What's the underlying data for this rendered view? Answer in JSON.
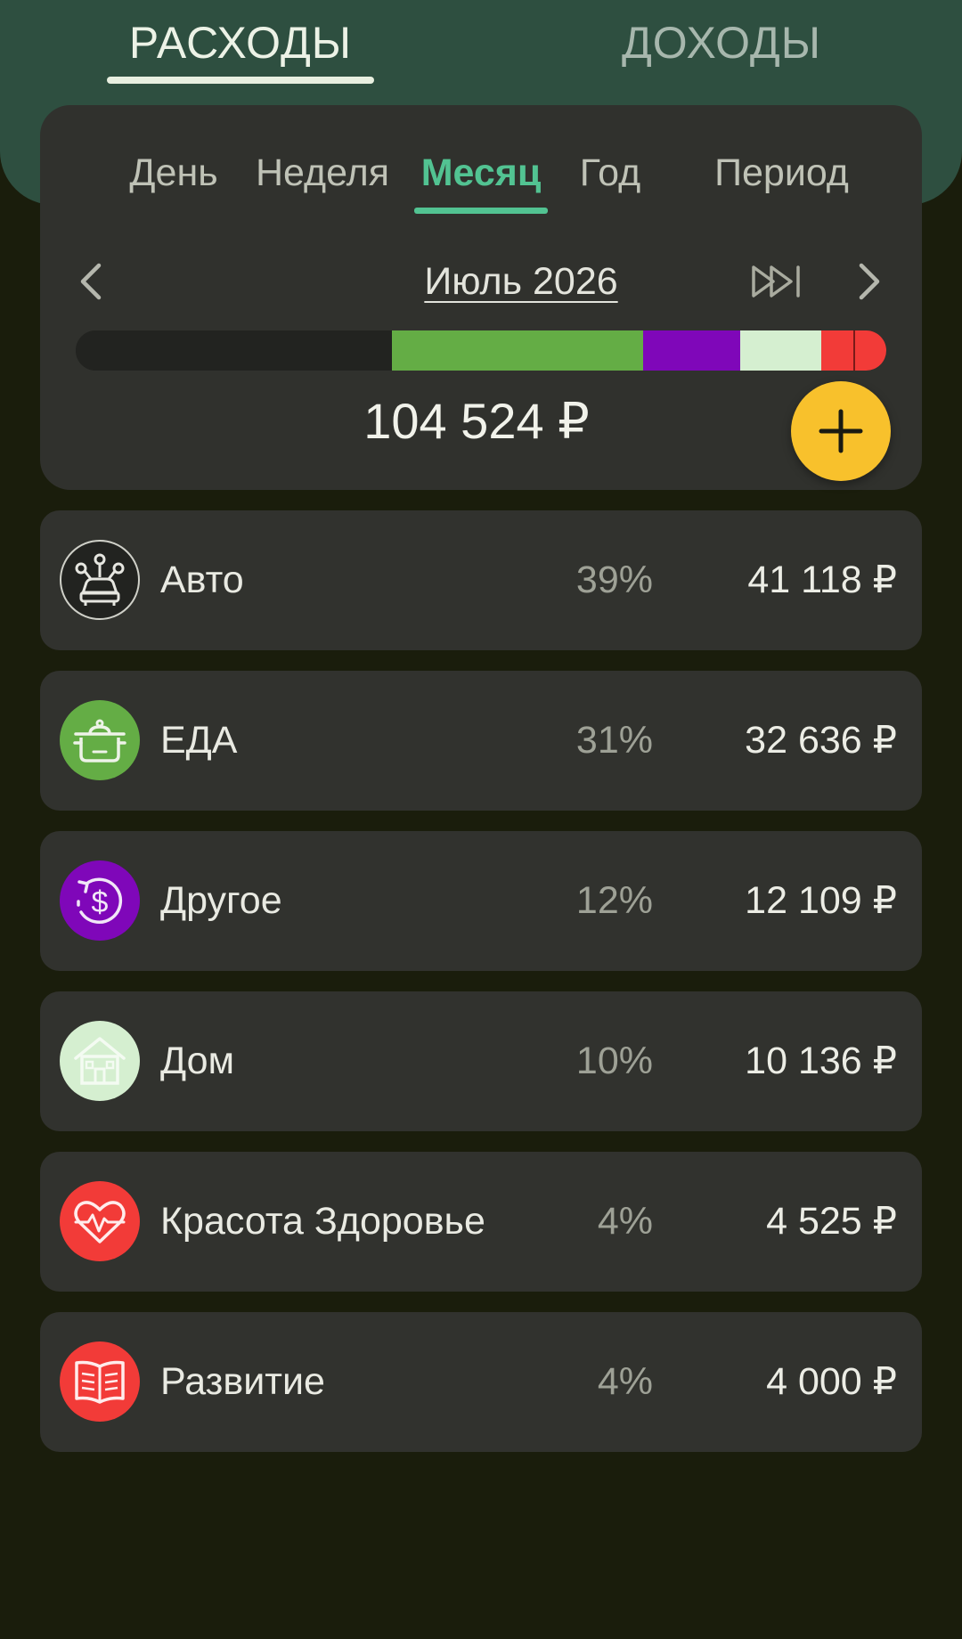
{
  "top_tabs": {
    "expenses": "РАСХОДЫ",
    "income": "ДОХОДЫ"
  },
  "period_tabs": [
    "День",
    "Неделя",
    "Месяц",
    "Год",
    "Период"
  ],
  "active_period": "Месяц",
  "current_period": "Июль 2026",
  "total": "104 524 ₽",
  "colors": {
    "accent": "#52c392",
    "header": "#2e4f40",
    "fab": "#f8c12c",
    "avto": "#222320",
    "eda": "#64ad45",
    "drugoe": "#7f07b9",
    "dom": "#d5efd0",
    "krasota": "#f23b38",
    "razvitie": "#f23b38"
  },
  "categories": [
    {
      "name": "Авто",
      "percent": "39%",
      "amount": "41 118 ₽",
      "icon": "car-icon",
      "share": 0.39
    },
    {
      "name": "ЕДА",
      "percent": "31%",
      "amount": "32 636 ₽",
      "icon": "pot-icon",
      "share": 0.31
    },
    {
      "name": "Другое",
      "percent": "12%",
      "amount": "12 109 ₽",
      "icon": "dollar-cycle-icon",
      "share": 0.12
    },
    {
      "name": "Дом",
      "percent": "10%",
      "amount": "10 136 ₽",
      "icon": "house-icon",
      "share": 0.1
    },
    {
      "name": "Красота Здоровье",
      "percent": "4%",
      "amount": "4 525 ₽",
      "icon": "heart-pulse-icon",
      "share": 0.04
    },
    {
      "name": "Развитие",
      "percent": "4%",
      "amount": "4 000 ₽",
      "icon": "book-icon",
      "share": 0.04
    }
  ]
}
